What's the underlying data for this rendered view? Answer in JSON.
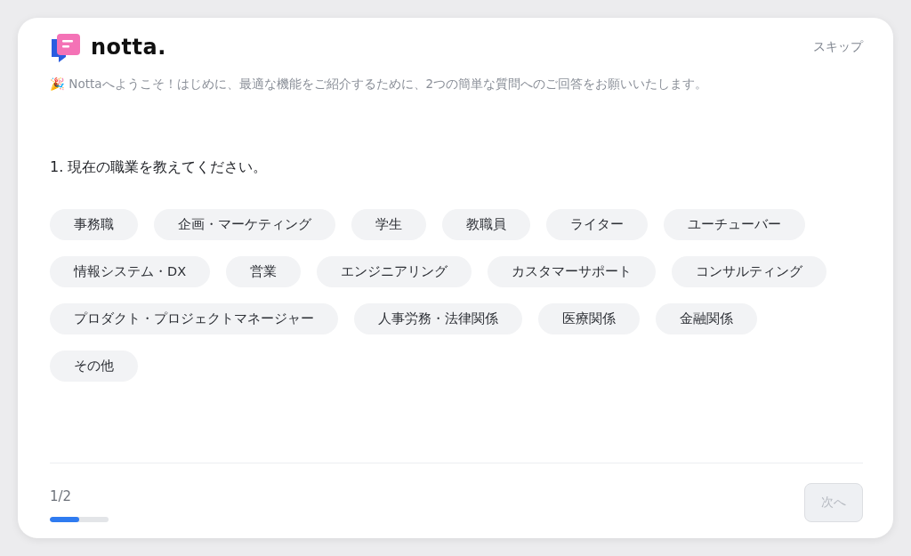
{
  "logo": {
    "text": "notta."
  },
  "skip": {
    "label": "スキップ"
  },
  "welcome": "🎉 Nottaへようこそ！はじめに、最適な機能をご紹介するために、2つの簡単な質問へのご回答をお願いいたします。",
  "question": "1. 現在の職業を教えてください。",
  "option_rows": [
    [
      {
        "label": "事務職",
        "selected": false
      },
      {
        "label": "企画・マーケティング",
        "selected": false
      },
      {
        "label": "学生",
        "selected": false
      },
      {
        "label": "教職員",
        "selected": false
      },
      {
        "label": "ライター",
        "selected": false
      },
      {
        "label": "ユーチューバー",
        "selected": false
      }
    ],
    [
      {
        "label": "情報システム・DX",
        "selected": false
      },
      {
        "label": "営業",
        "selected": false
      },
      {
        "label": "エンジニアリング",
        "selected": false
      },
      {
        "label": "カスタマーサポート",
        "selected": false
      },
      {
        "label": "コンサルティング",
        "selected": false
      }
    ],
    [
      {
        "label": "プロダクト・プロジェクトマネージャー",
        "selected": false
      },
      {
        "label": "人事労務・法律関係",
        "selected": false
      },
      {
        "label": "医療関係",
        "selected": false
      },
      {
        "label": "金融関係",
        "selected": false
      }
    ],
    [
      {
        "label": "その他",
        "selected": false
      }
    ]
  ],
  "progress": {
    "text": "1/2",
    "level": 0.5
  },
  "next_button": {
    "label": "次へ",
    "disabled": true
  }
}
